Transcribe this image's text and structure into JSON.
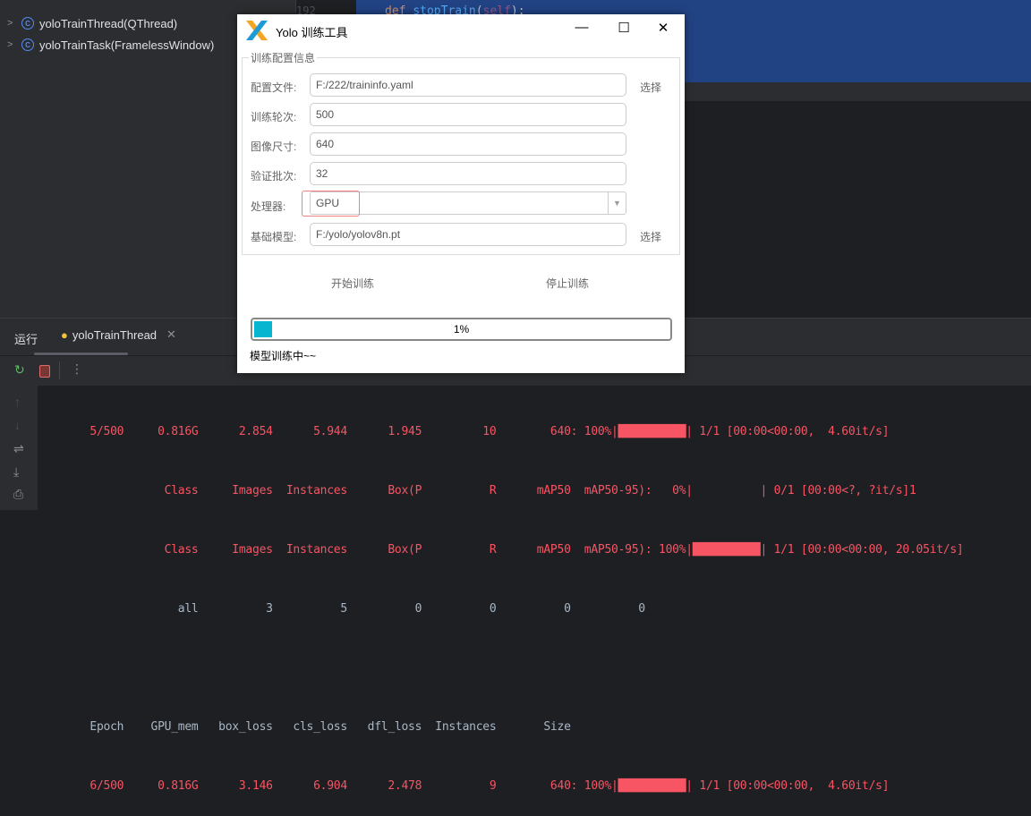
{
  "ide": {
    "tree": [
      {
        "label": "yoloTrainThread(QThread)"
      },
      {
        "label": "yoloTrainTask(FramelessWindow)"
      }
    ],
    "line_number": "192",
    "code": {
      "kw": "def ",
      "fn": "stopTrain",
      "open": "(",
      "self": "self",
      "close": "):"
    },
    "run_label": "运行",
    "run_tab": "yoloTrainThread",
    "console_lines": [
      {
        "cls": "red",
        "text": "      5/500     0.816G      2.854      5.944      1.945         10        640: 100%|██████████| 1/1 [00:00<00:00,  4.60it/s]"
      },
      {
        "cls": "red",
        "text": "                 Class     Images  Instances      Box(P          R      mAP50  mAP50-95):   0%|          | 0/1 [00:00<?, ?it/s]1"
      },
      {
        "cls": "red",
        "text": "                 Class     Images  Instances      Box(P          R      mAP50  mAP50-95): 100%|██████████| 1/1 [00:00<00:00, 20.05it/s]"
      },
      {
        "cls": "gray",
        "text": "                   all          3          5          0          0          0          0"
      },
      {
        "cls": "gray",
        "text": ""
      },
      {
        "cls": "gray",
        "text": "      Epoch    GPU_mem   box_loss   cls_loss   dfl_loss  Instances       Size"
      },
      {
        "cls": "red",
        "text": "      6/500     0.816G      3.146      6.904      2.478          9        640: 100%|██████████| 1/1 [00:00<00:00,  4.60it/s]"
      }
    ]
  },
  "dialog": {
    "title": "Yolo 训练工具",
    "group_title": "训练配置信息",
    "rows": [
      {
        "label": "配置文件:",
        "value": "F:/222/traininfo.yaml",
        "pick": "选择"
      },
      {
        "label": "训练轮次:",
        "value": "500"
      },
      {
        "label": "图像尺寸:",
        "value": "640"
      },
      {
        "label": "验证批次:",
        "value": "32"
      },
      {
        "label": "处理器:",
        "value": "GPU"
      },
      {
        "label": "基础模型:",
        "value": "F:/yolo/yolov8n.pt",
        "pick": "选择"
      }
    ],
    "start_button": "开始训练",
    "stop_button": "停止训练",
    "progress": 1,
    "progress_text": "1%",
    "status": "模型训练中~~"
  },
  "colors": {
    "accent": "#06b6d0",
    "console_red": "#f75464",
    "selection": "#214283"
  }
}
